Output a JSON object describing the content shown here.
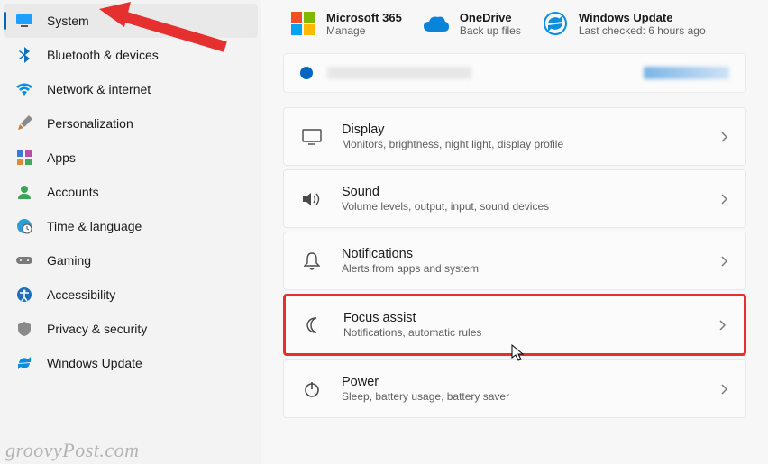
{
  "sidebar": {
    "items": [
      {
        "label": "System",
        "selected": true
      },
      {
        "label": "Bluetooth & devices",
        "selected": false
      },
      {
        "label": "Network & internet",
        "selected": false
      },
      {
        "label": "Personalization",
        "selected": false
      },
      {
        "label": "Apps",
        "selected": false
      },
      {
        "label": "Accounts",
        "selected": false
      },
      {
        "label": "Time & language",
        "selected": false
      },
      {
        "label": "Gaming",
        "selected": false
      },
      {
        "label": "Accessibility",
        "selected": false
      },
      {
        "label": "Privacy & security",
        "selected": false
      },
      {
        "label": "Windows Update",
        "selected": false
      }
    ]
  },
  "topCards": {
    "ms365": {
      "title": "Microsoft 365",
      "sub": "Manage"
    },
    "onedrive": {
      "title": "OneDrive",
      "sub": "Back up files"
    },
    "update": {
      "title": "Windows Update",
      "sub": "Last checked: 6 hours ago"
    }
  },
  "settings": [
    {
      "title": "Display",
      "sub": "Monitors, brightness, night light, display profile"
    },
    {
      "title": "Sound",
      "sub": "Volume levels, output, input, sound devices"
    },
    {
      "title": "Notifications",
      "sub": "Alerts from apps and system"
    },
    {
      "title": "Focus assist",
      "sub": "Notifications, automatic rules",
      "highlighted": true
    },
    {
      "title": "Power",
      "sub": "Sleep, battery usage, battery saver"
    }
  ],
  "watermark": "groovyPost.com"
}
